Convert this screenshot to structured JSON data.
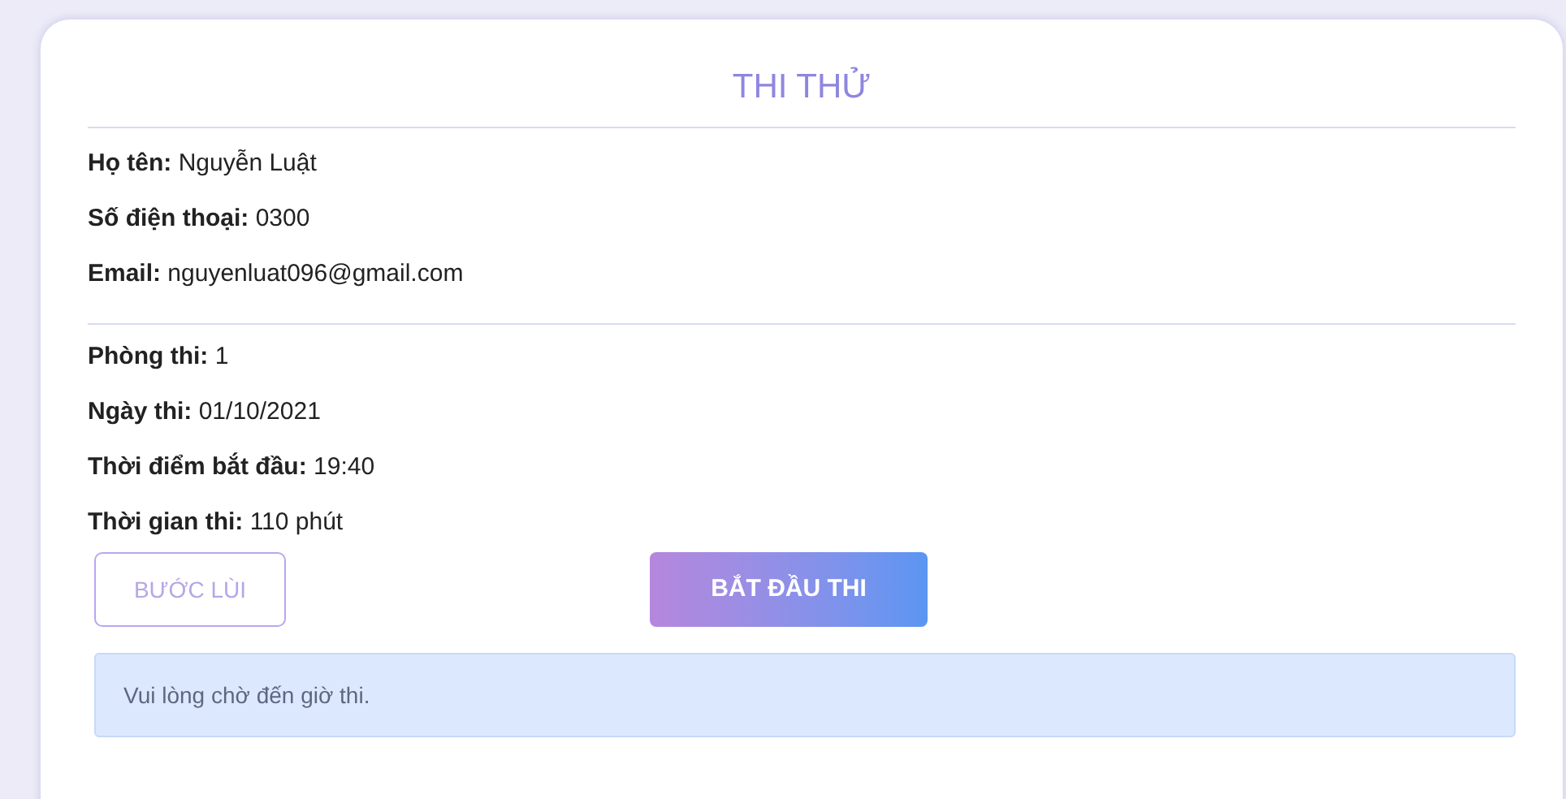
{
  "title": "THI THỬ",
  "sections": [
    {
      "rows": [
        "**Họ tên:** Nguyễn Luật",
        "**Số điện thoại:** 0300",
        "**Email:** nguyenluat096@gmail.com"
      ]
    },
    {
      "rows": [
        "**Phòng thi:** 1",
        "**Ngày thi:** 01/10/2021",
        "**Thời điểm bắt đầu:** 19:40",
        "**Thời gian thi:** 110 phút"
      ]
    }
  ],
  "buttons": [
    {
      "label": "BƯỚC LÙI",
      "kind": "outline"
    },
    {
      "label": "BẮT ĐẦU THI",
      "kind": "primary"
    }
  ],
  "alert": "Vui lòng chờ đến giờ thi."
}
